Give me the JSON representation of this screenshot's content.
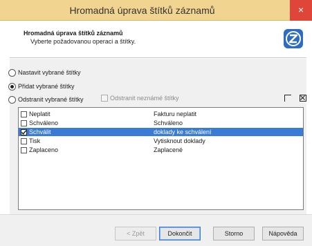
{
  "window": {
    "title": "Hromadná úprava štítků záznamů",
    "close_glyph": "×"
  },
  "header": {
    "heading": "Hromadná úprava štítků záznamů",
    "subtitle": "Vyberte požadovanou operaci a štítky.",
    "logo_icon": "app-logo-icon"
  },
  "options": {
    "set": "Nastavit vybrané štítky",
    "add": "Přidat vybrané štítky",
    "remove": "Odstranit vybrané štítky",
    "remove_unknown": "Odstranit neznámé štítky",
    "selected": "add"
  },
  "select_icons": {
    "none": "deselect-all-icon",
    "all": "select-all-icon"
  },
  "labels": [
    {
      "name": "Neplatit",
      "description": "Fakturu neplatit",
      "checked": false,
      "selected": false
    },
    {
      "name": "Schváleno",
      "description": "Schváleno",
      "checked": false,
      "selected": false
    },
    {
      "name": "Schválit",
      "description": "doklady ke schválení",
      "checked": true,
      "selected": true
    },
    {
      "name": "Tisk",
      "description": "Vytisknout doklady",
      "checked": false,
      "selected": false
    },
    {
      "name": "Zaplaceno",
      "description": "Zaplacené",
      "checked": false,
      "selected": false
    }
  ],
  "buttons": {
    "back": "< Zpět",
    "finish": "Dokončit",
    "cancel": "Storno",
    "help": "Nápověda"
  },
  "colors": {
    "titlebar": "#f1d48f",
    "close": "#e0453a",
    "selection": "#3a7bd5",
    "logo": "#2f6cc0"
  }
}
